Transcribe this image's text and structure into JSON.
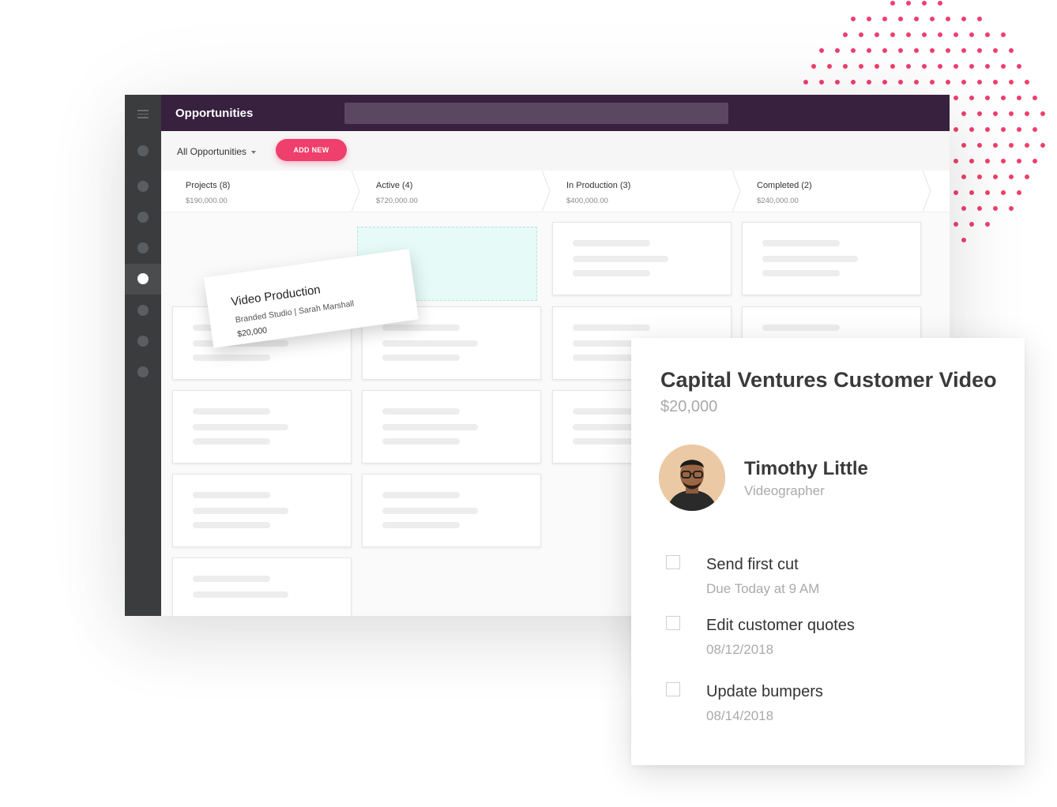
{
  "app": {
    "title": "Opportunities"
  },
  "toolbar": {
    "filter_label": "All Opportunities",
    "add_new_label": "ADD NEW"
  },
  "stages": [
    {
      "label": "Projects (8)",
      "amount": "$190,000.00"
    },
    {
      "label": "Active (4)",
      "amount": "$720,000.00"
    },
    {
      "label": "In Production (3)",
      "amount": "$400,000.00"
    },
    {
      "label": "Completed (2)",
      "amount": "$240,000.00"
    }
  ],
  "dragging_card": {
    "title": "Video Production",
    "subtitle": "Branded Studio | Sarah Marshall",
    "value": "$20,000"
  },
  "detail": {
    "title": "Capital Ventures Customer Video",
    "value": "$20,000",
    "person": {
      "name": "Timothy Little",
      "role": "Videographer"
    },
    "tasks": [
      {
        "label": "Send first cut",
        "due": "Due Today at 9 AM"
      },
      {
        "label": "Edit customer quotes",
        "due": "08/12/2018"
      },
      {
        "label": "Update bumpers",
        "due": "08/14/2018"
      }
    ]
  },
  "colors": {
    "topbar": "#38203f",
    "accent": "#ef3f6c",
    "rail": "#3a3c3d",
    "drop_zone": "#e6faf7",
    "dot_pattern": "#ef3f6c"
  },
  "icons": {
    "menu": "hamburger-icon",
    "caret": "caret-down-icon",
    "checkbox": "checkbox-icon"
  }
}
